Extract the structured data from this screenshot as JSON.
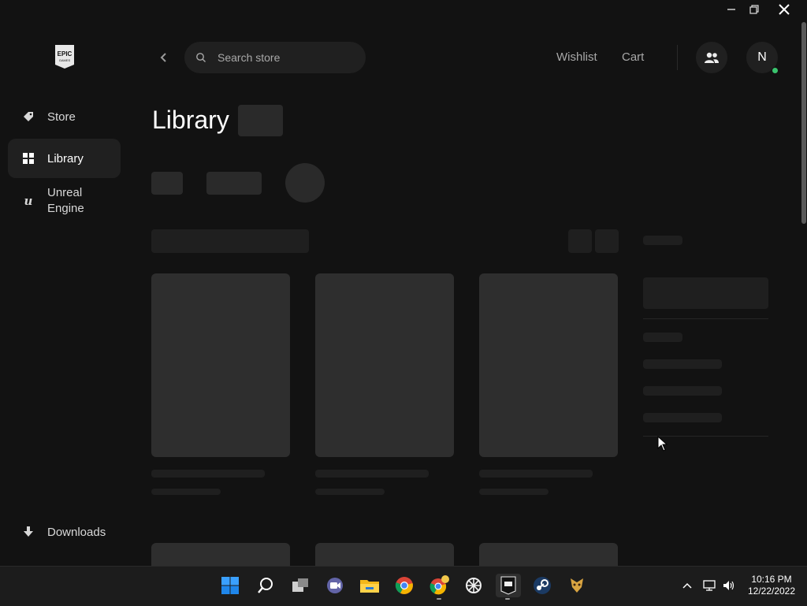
{
  "window": {
    "minimize_icon": "minimize-icon",
    "restore_icon": "restore-icon",
    "close_icon": "close-icon"
  },
  "app": {
    "logo_text_top": "EPIC",
    "logo_text_bottom": "GAMES"
  },
  "sidebar": {
    "items": [
      {
        "label": "Store",
        "icon": "tag-icon",
        "active": false
      },
      {
        "label": "Library",
        "icon": "grid-icon",
        "active": true
      },
      {
        "label": "Unreal Engine",
        "icon": "unreal-engine-icon",
        "active": false
      }
    ],
    "downloads": {
      "label": "Downloads",
      "icon": "download-icon"
    }
  },
  "header": {
    "search_placeholder": "Search store",
    "wishlist_label": "Wishlist",
    "cart_label": "Cart",
    "avatar_initial": "N"
  },
  "main": {
    "title": "Library"
  },
  "taskbar": {
    "apps": [
      {
        "name": "windows-start-icon"
      },
      {
        "name": "search-icon"
      },
      {
        "name": "task-view-icon"
      },
      {
        "name": "teams-chat-icon"
      },
      {
        "name": "file-explorer-icon"
      },
      {
        "name": "chrome-icon"
      },
      {
        "name": "chrome-profile-icon"
      },
      {
        "name": "app-icon"
      },
      {
        "name": "epic-games-icon",
        "active": true
      },
      {
        "name": "steam-icon"
      },
      {
        "name": "game-icon"
      }
    ],
    "time": "10:16 PM",
    "date": "12/22/2022"
  },
  "colors": {
    "background": "#121212",
    "surface": "#202020",
    "skeleton": "#2e2e2e",
    "online": "#3ac46e"
  }
}
